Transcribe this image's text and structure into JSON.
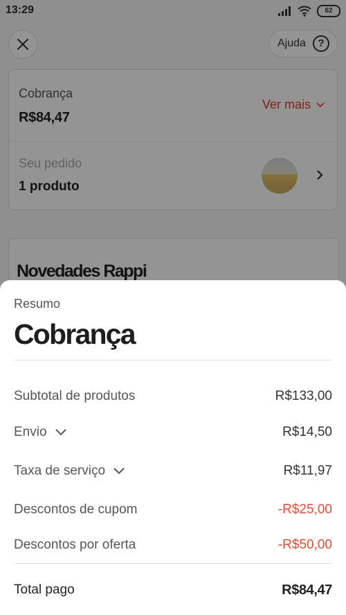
{
  "status_bar": {
    "time": "13:29",
    "battery": "62"
  },
  "header": {
    "help_label": "Ajuda"
  },
  "charge_card": {
    "title": "Cobrança",
    "amount": "R$84,47",
    "ver_mais": "Ver mais",
    "order_title": "Seu pedido",
    "order_count": "1 produto"
  },
  "novedades": {
    "title": "Novedades Rappi"
  },
  "summary": {
    "subtitle": "Resumo",
    "title": "Cobrança",
    "rows": [
      {
        "label": "Subtotal de produtos",
        "value": "R$133,00"
      },
      {
        "label": "Envio",
        "value": "R$14,50"
      },
      {
        "label": "Taxa de serviço",
        "value": "R$11,97"
      },
      {
        "label": "Descontos de cupom",
        "value": "-R$25,00"
      },
      {
        "label": "Descontos por oferta",
        "value": "-R$50,00"
      }
    ],
    "total_label": "Total pago",
    "total_value": "R$84,47"
  },
  "colors": {
    "accent": "#e84a2f"
  }
}
